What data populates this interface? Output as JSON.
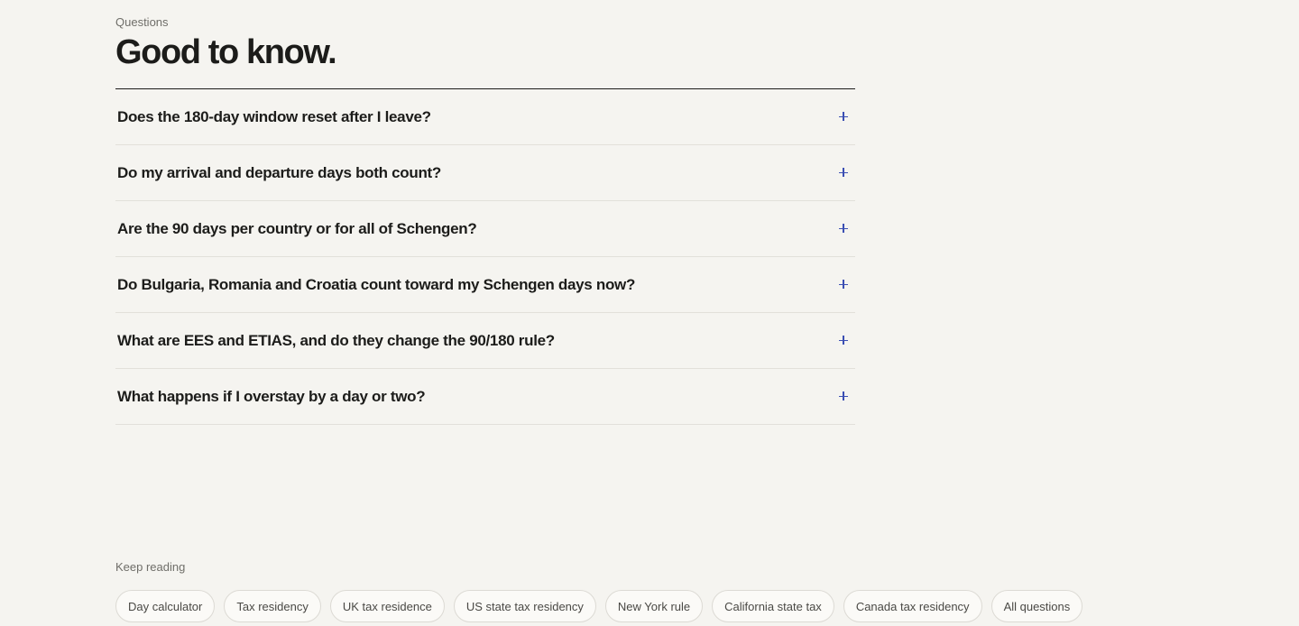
{
  "faq": {
    "eyebrow": "Questions",
    "title": "Good to know.",
    "items": [
      {
        "question": "Does the 180-day window reset after I leave?",
        "icon": "plus-icon"
      },
      {
        "question": "Do my arrival and departure days both count?",
        "icon": "plus-icon"
      },
      {
        "question": "Are the 90 days per country or for all of Schengen?",
        "icon": "plus-icon"
      },
      {
        "question": "Do Bulgaria, Romania and Croatia count toward my Schengen days now?",
        "icon": "plus-icon"
      },
      {
        "question": "What are EES and ETIAS, and do they change the 90/180 rule?",
        "icon": "plus-icon"
      },
      {
        "question": "What happens if I overstay by a day or two?",
        "icon": "plus-icon"
      }
    ],
    "accent_color": "#3b4fb3"
  },
  "keep_reading": {
    "label": "Keep reading",
    "links": [
      "Day calculator",
      "Tax residency",
      "UK tax residence",
      "US state tax residency",
      "New York rule",
      "California state tax",
      "Canada tax residency",
      "All questions"
    ]
  }
}
